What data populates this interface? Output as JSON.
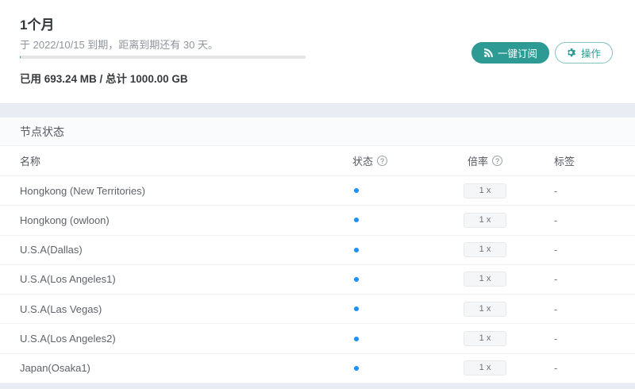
{
  "colors": {
    "accent": "#2d9b94",
    "status_dot": "#1890ff"
  },
  "plan": {
    "title": "1个月",
    "expiry_text": "于 2022/10/15 到期，距离到期还有 30 天。",
    "usage_text": "已用 693.24 MB / 总计 1000.00 GB",
    "used": "693.24 MB",
    "total": "1000.00 GB",
    "progress_percent": 0.07,
    "buttons": {
      "subscribe": "一键订阅",
      "actions": "操作"
    }
  },
  "nodes": {
    "section_title": "节点状态",
    "columns": {
      "name": "名称",
      "status": "状态",
      "rate": "倍率",
      "tag": "标签"
    },
    "help_icon": "?",
    "rows": [
      {
        "name": "Hongkong (New Territories)",
        "status": "online",
        "rate": "1 x",
        "tag": "-"
      },
      {
        "name": "Hongkong (owloon)",
        "status": "online",
        "rate": "1 x",
        "tag": "-"
      },
      {
        "name": "U.S.A(Dallas)",
        "status": "online",
        "rate": "1 x",
        "tag": "-"
      },
      {
        "name": "U.S.A(Los Angeles1)",
        "status": "online",
        "rate": "1 x",
        "tag": "-"
      },
      {
        "name": "U.S.A(Las Vegas)",
        "status": "online",
        "rate": "1 x",
        "tag": "-"
      },
      {
        "name": "U.S.A(Los Angeles2)",
        "status": "online",
        "rate": "1 x",
        "tag": "-"
      },
      {
        "name": "Japan(Osaka1)",
        "status": "online",
        "rate": "1 x",
        "tag": "-"
      }
    ]
  }
}
